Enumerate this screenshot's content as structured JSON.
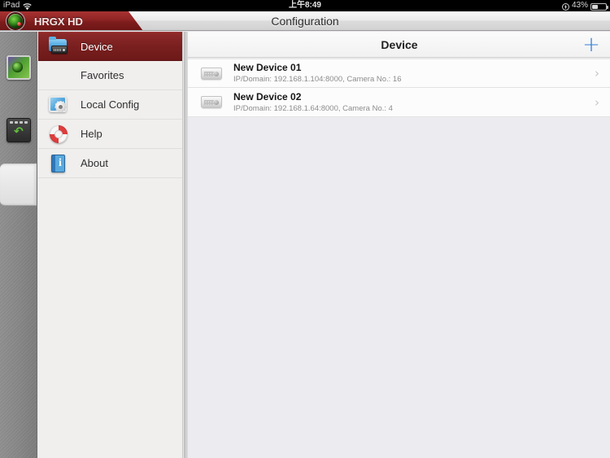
{
  "statusbar": {
    "carrier": "iPad",
    "wifi_icon": "wifi-icon",
    "time": "上午8:49",
    "location_icon": "location-services-icon",
    "battery_percent": "43%",
    "battery_level": 43
  },
  "topbar": {
    "app_tab_label": "HRGX HD",
    "logo_icon": "camera-lens-logo-icon",
    "title": "Configuration"
  },
  "rail": {
    "items": [
      {
        "name": "live-view",
        "icon": "live-view-icon",
        "selected": false
      },
      {
        "name": "playback",
        "icon": "playback-icon",
        "selected": false
      },
      {
        "name": "configuration",
        "icon": "gear-icon",
        "selected": true
      }
    ]
  },
  "menu": {
    "items": [
      {
        "label": "Device",
        "icon": "device-folder-icon",
        "active": true
      },
      {
        "label": "Favorites",
        "icon": "star-icon",
        "active": false
      },
      {
        "label": "Local Config",
        "icon": "local-config-icon",
        "active": false
      },
      {
        "label": "Help",
        "icon": "lifebuoy-icon",
        "active": false
      },
      {
        "label": "About",
        "icon": "about-book-icon",
        "active": false
      }
    ]
  },
  "content": {
    "title": "Device",
    "add_label": "+",
    "devices": [
      {
        "name": "New Device 01",
        "details": "IP/Domain: 192.168.1.104:8000, Camera No.: 16",
        "chevron": "›"
      },
      {
        "name": "New Device 02",
        "details": "IP/Domain: 192.168.1.64:8000, Camera No.: 4",
        "chevron": "›"
      }
    ]
  },
  "colors": {
    "brand_red": "#7a1f1f",
    "accent_blue": "#2f7fd8",
    "panel_bg": "#f0efee",
    "content_bg": "#ecebf0"
  }
}
